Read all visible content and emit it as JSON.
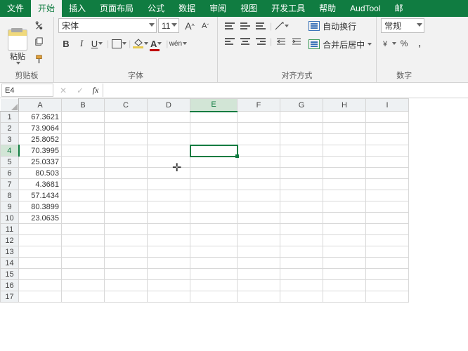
{
  "tabs": [
    "文件",
    "开始",
    "插入",
    "页面布局",
    "公式",
    "数据",
    "审阅",
    "视图",
    "开发工具",
    "帮助",
    "AudTool",
    "邮"
  ],
  "ribbon": {
    "clipboard": {
      "paste": "粘贴",
      "title": "剪贴板"
    },
    "font": {
      "name": "宋体",
      "size": "11",
      "aplus": "A",
      "aminus": "A",
      "b": "B",
      "i": "I",
      "u": "U",
      "wen": "wén",
      "title": "字体"
    },
    "alignment": {
      "wrap": "自动换行",
      "merge": "合并后居中",
      "title": "对齐方式"
    },
    "number": {
      "format": "常规",
      "title": "数字"
    }
  },
  "name_box": "E4",
  "fx": "fx",
  "columns": [
    "A",
    "B",
    "C",
    "D",
    "E",
    "F",
    "G",
    "H",
    "I"
  ],
  "selected_col_idx": 4,
  "selected_row": 4,
  "colA": [
    "67.3621",
    "73.9064",
    "25.8052",
    "70.3995",
    "25.0337",
    "80.503",
    "4.3681",
    "57.1434",
    "80.3899",
    "23.0635"
  ],
  "row_count": 17
}
